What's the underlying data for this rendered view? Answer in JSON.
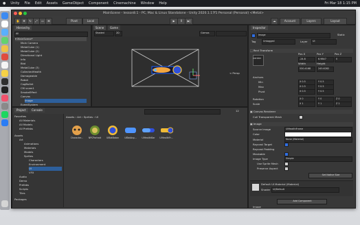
{
  "menu": {
    "items": [
      "Unity",
      "File",
      "Edit",
      "Assets",
      "GameObject",
      "Component",
      "Cinemachine",
      "Window",
      "Help"
    ],
    "status": [
      "Fri Mar 18  1:15 PM"
    ]
  },
  "window": {
    "title": "MainScene - lesson8.1 - PC, Mac & Linux Standalone - Unity 2020.1.17f1 Personal (Personal) <Metal>"
  },
  "toolbar": {
    "pivot": "Pivot",
    "local": "Local",
    "account": "Account",
    "layers": "Layers",
    "layout": "Layout"
  },
  "hierarchy": {
    "tab": "Hierarchy",
    "search_placeholder": "All",
    "items": [
      "MainScene*",
      "Main Camera",
      "MetalCube (1)",
      "MetalCube (2)",
      "Directional Light",
      "Info",
      "Bkd",
      "MetalCube (3)",
      "CollectedHealth",
      "Damageable",
      "Robot",
      "CogBullet",
      "CM vcam1",
      "SmokeEffect",
      "Canvas",
      "Image",
      "EventSystem"
    ]
  },
  "scene": {
    "tabs": [
      "Scene",
      "Game"
    ],
    "mode": "Shaded",
    "dim": "2D",
    "gizmos": "Gizmos",
    "persp": "< Persp"
  },
  "project": {
    "tabs": [
      "Project",
      "Console"
    ],
    "breadcrumb": [
      "Assets",
      "Art",
      "Sprites",
      "UI"
    ],
    "favorites": [
      "Favorites",
      "All Materials",
      "All Models",
      "All Prefabs"
    ],
    "tree": [
      "Assets",
      "Art",
      "Animations",
      "Materials",
      "Models",
      "Sprites",
      "Characters",
      "Environment",
      "UI",
      "VFX",
      "Audio",
      "Demo",
      "Prefabs",
      "Scripts",
      "Tiles",
      "Packages"
    ],
    "assets": [
      "Character...",
      "NPCPortrait",
      "UIBatBaton",
      "UIBatAsp...",
      "UIHealthBar",
      "UIHealthFr..."
    ],
    "count": "12"
  },
  "inspector": {
    "tab": "Inspector",
    "name": "Image",
    "static": "Static",
    "tag_label": "Tag",
    "tag": "Untagged",
    "layer_label": "Layer",
    "layer": "UI",
    "rect_title": "Rect Transform",
    "center": "center",
    "pos_labels": [
      "Pos X",
      "Pos Y",
      "Pos Z"
    ],
    "pos_values": [
      "-24.8",
      "6.9847",
      "0"
    ],
    "size_labels": [
      "Width",
      "Height"
    ],
    "size_values": [
      "530.4168",
      "245.6282"
    ],
    "anchors": "Anchors",
    "min": "Min",
    "max": "Max",
    "pivot": "Pivot",
    "min_values": [
      "X 0.5",
      "Y 0.5"
    ],
    "max_values": [
      "X 0.5",
      "Y 0.5"
    ],
    "pivot_values": [
      "X 0.5",
      "Y 0.5"
    ],
    "rotation": "Rotation",
    "rotation_values": [
      "X 0",
      "Y 0",
      "Z 0"
    ],
    "scale": "Scale",
    "scale_values": [
      "X 1",
      "Y 1",
      "Z 1"
    ],
    "canvas_renderer": "Canvas Renderer",
    "cull": "Cull Transparent Mesh",
    "image_title": "Image",
    "source_image_label": "Source Image",
    "source_image": "UIHealthFrame",
    "color_label": "Color",
    "material_label": "Material",
    "material": "None (Material)",
    "raycast_target": "Raycast Target",
    "raycast_padding": "Raycast Padding",
    "maskable": "Maskable",
    "image_type_label": "Image Type",
    "image_type": "Simple",
    "use_sprite_mesh": "Use Sprite Mesh",
    "preserve_aspect": "Preserve Aspect",
    "native_size": "Set Native Size",
    "default_material": "Default UI Material (Material)",
    "shader_label": "Shader",
    "shader": "UI/Default",
    "add_component": "Add Component",
    "footer": "Image"
  }
}
